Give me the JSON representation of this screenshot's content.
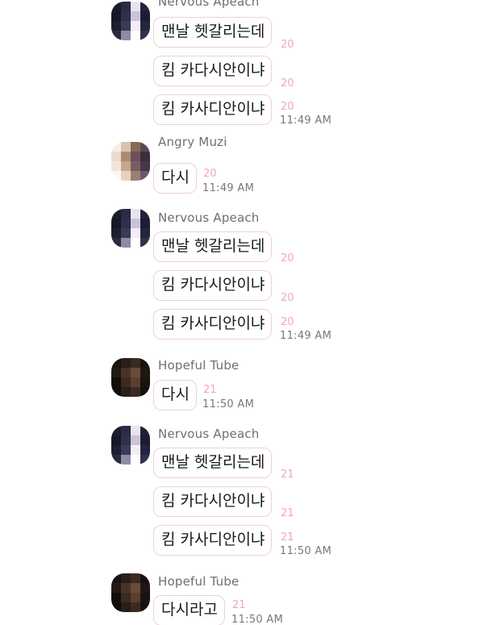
{
  "messages": [
    {
      "sender": "Nervous Apeach",
      "bubbles": [
        {
          "text": "맨날 헷갈리는데",
          "count": "20"
        },
        {
          "text": "킴 카다시안이냐",
          "count": "20"
        },
        {
          "text": "킴 카사디안이냐",
          "count": "20",
          "time": "11:49 AM"
        }
      ]
    },
    {
      "sender": "Angry Muzi",
      "bubbles": [
        {
          "text": "다시",
          "count": "20",
          "time": "11:49 AM"
        }
      ]
    },
    {
      "sender": "Nervous Apeach",
      "bubbles": [
        {
          "text": "맨날 헷갈리는데",
          "count": "20"
        },
        {
          "text": "킴 카다시안이냐",
          "count": "20"
        },
        {
          "text": "킴 카사디안이냐",
          "count": "20",
          "time": "11:49 AM"
        }
      ]
    },
    {
      "sender": "Hopeful Tube",
      "bubbles": [
        {
          "text": "다시",
          "count": "21",
          "time": "11:50 AM"
        }
      ]
    },
    {
      "sender": "Nervous Apeach",
      "bubbles": [
        {
          "text": "맨날 헷갈리는데",
          "count": "21"
        },
        {
          "text": "킴 카다시안이냐",
          "count": "21"
        },
        {
          "text": "킴 카사디안이냐",
          "count": "21",
          "time": "11:50 AM"
        }
      ]
    },
    {
      "sender": "Hopeful Tube",
      "bubbles": [
        {
          "text": "다시라고",
          "count": "21",
          "time": "11:50 AM"
        }
      ]
    }
  ]
}
